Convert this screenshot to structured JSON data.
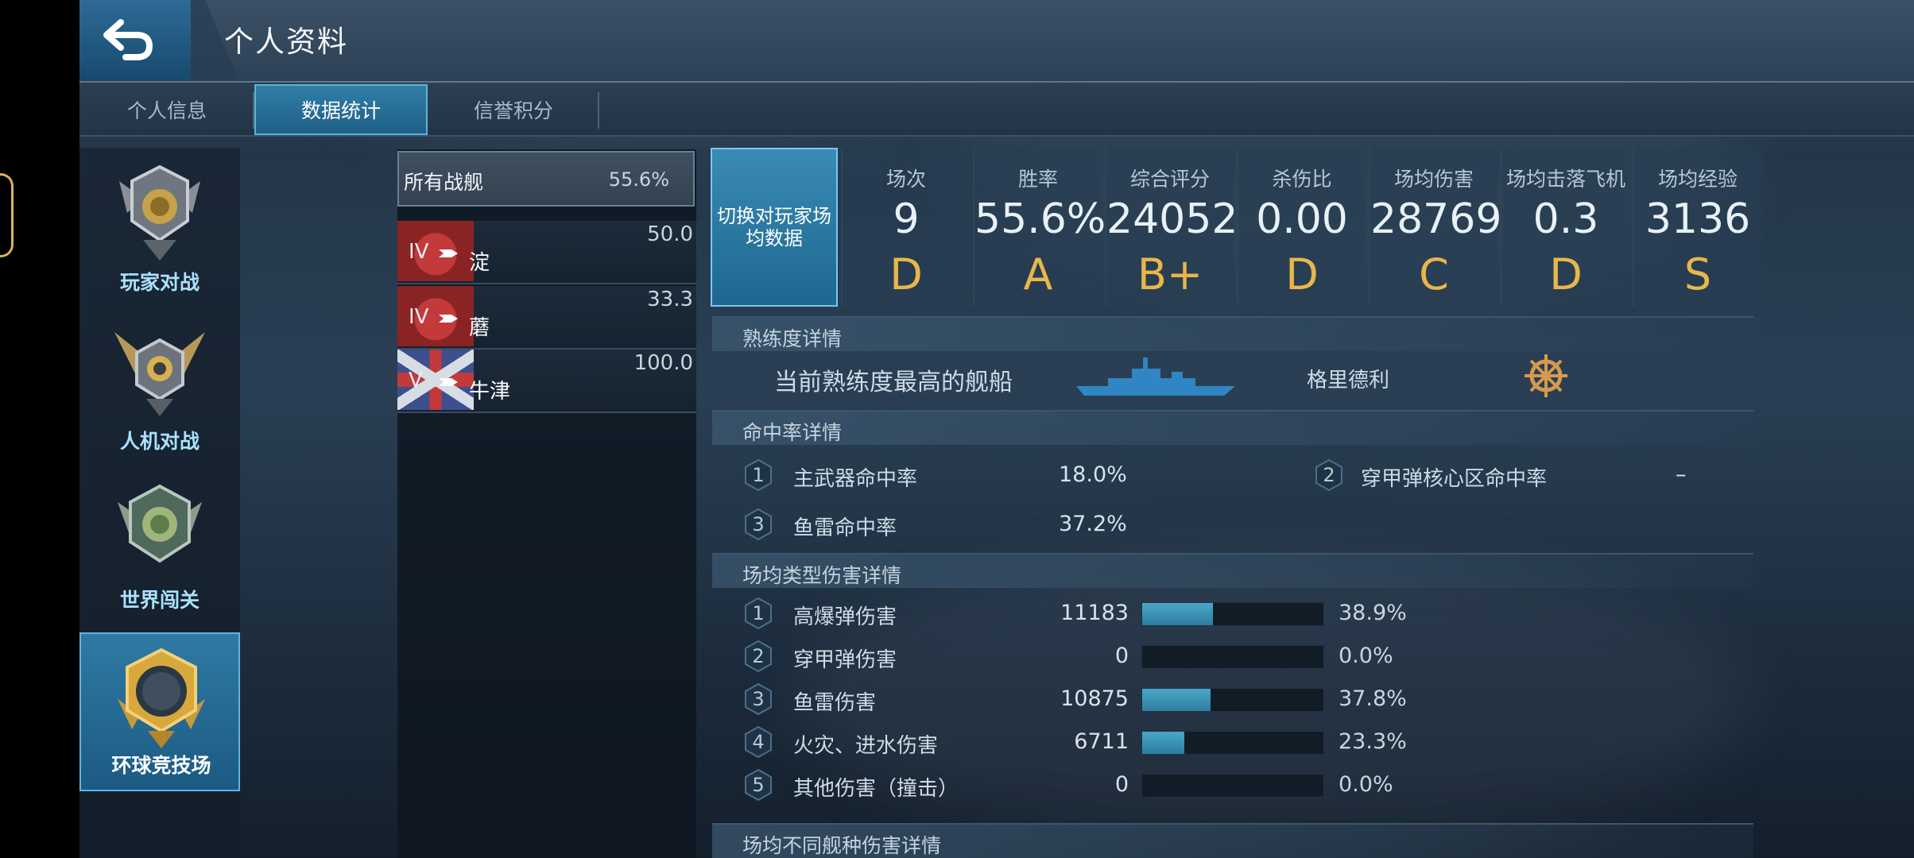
{
  "page_title": "个人资料",
  "tabs": [
    {
      "label": "个人信息",
      "active": false
    },
    {
      "label": "数据统计",
      "active": true
    },
    {
      "label": "信誉积分",
      "active": false
    }
  ],
  "modes": [
    {
      "label": "玩家对战",
      "active": false
    },
    {
      "label": "人机对战",
      "active": false
    },
    {
      "label": "世界闯关",
      "active": false
    },
    {
      "label": "环球竞技场",
      "active": true
    }
  ],
  "ships": {
    "all": {
      "label": "所有战舰",
      "value": "55.6%"
    },
    "items": [
      {
        "tier": "IV",
        "name": "淀",
        "value": "50.0"
      },
      {
        "tier": "IV",
        "name": "蘑",
        "value": "33.3"
      },
      {
        "tier": "V",
        "name": "牛津",
        "value": "100.0"
      }
    ]
  },
  "switch_button": "切换对玩家场均数据",
  "stats": [
    {
      "label": "场次",
      "value": "9",
      "grade": "D"
    },
    {
      "label": "胜率",
      "value": "55.6%",
      "grade": "A"
    },
    {
      "label": "综合评分",
      "value": "24052",
      "grade": "B+"
    },
    {
      "label": "杀伤比",
      "value": "0.00",
      "grade": "D"
    },
    {
      "label": "场均伤害",
      "value": "28769",
      "grade": "C"
    },
    {
      "label": "场均击落飞机",
      "value": "0.3",
      "grade": "D"
    },
    {
      "label": "场均经验",
      "value": "3136",
      "grade": "S"
    }
  ],
  "proficiency": {
    "title": "熟练度详情",
    "label": "当前熟练度最高的舰船",
    "ship": "格里德利"
  },
  "accuracy": {
    "title": "命中率详情",
    "items": [
      {
        "num": "1",
        "label": "主武器命中率",
        "value": "18.0%"
      },
      {
        "num": "2",
        "label": "穿甲弹核心区命中率",
        "value": "–"
      },
      {
        "num": "3",
        "label": "鱼雷命中率",
        "value": "37.2%"
      }
    ]
  },
  "damage_types": {
    "title": "场均类型伤害详情",
    "items": [
      {
        "num": "1",
        "label": "高爆弹伤害",
        "value": "11183",
        "percent": "38.9%",
        "fraction": 0.389
      },
      {
        "num": "2",
        "label": "穿甲弹伤害",
        "value": "0",
        "percent": "0.0%",
        "fraction": 0.0
      },
      {
        "num": "3",
        "label": "鱼雷伤害",
        "value": "10875",
        "percent": "37.8%",
        "fraction": 0.378
      },
      {
        "num": "4",
        "label": "火灾、进水伤害",
        "value": "6711",
        "percent": "23.3%",
        "fraction": 0.233
      },
      {
        "num": "5",
        "label": "其他伤害（撞击）",
        "value": "0",
        "percent": "0.0%",
        "fraction": 0.0
      }
    ]
  },
  "ship_type_damage": {
    "title": "场均不同舰种伤害详情"
  },
  "colors": {
    "accent": "#2f7fa8",
    "grade": "#e8b64a",
    "bar": "#3c95b8"
  }
}
